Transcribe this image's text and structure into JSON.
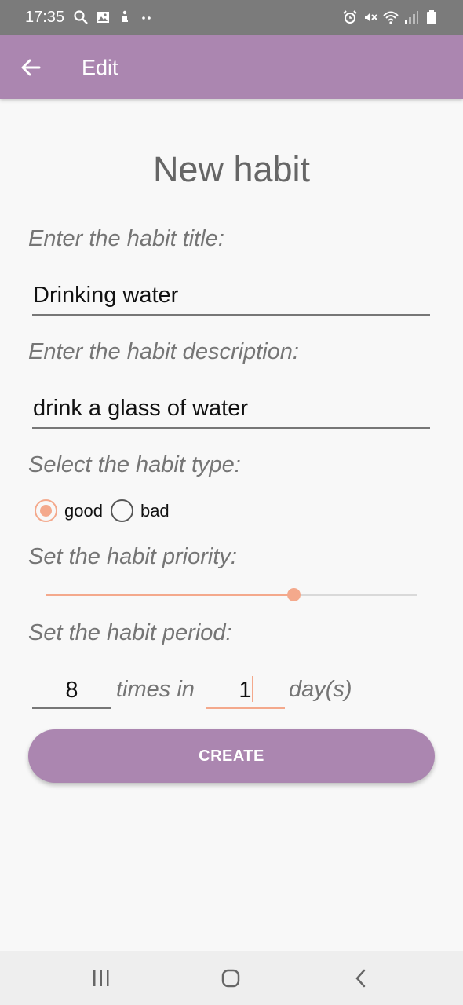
{
  "status_bar": {
    "time": "17:35",
    "left_icons": [
      "search-icon",
      "image-icon",
      "accessibility-icon",
      "more-dots-icon"
    ],
    "right_icons": [
      "alarm-icon",
      "mute-icon",
      "wifi-icon",
      "signal-icon",
      "battery-icon"
    ]
  },
  "app_bar": {
    "title": "Edit",
    "back_icon": "arrow-left-icon"
  },
  "form": {
    "heading": "New habit",
    "title_label": "Enter the habit title:",
    "title_value": "Drinking water",
    "description_label": "Enter the habit description:",
    "description_value": "drink a glass of water",
    "type_label": "Select the habit type:",
    "type_options": [
      "good",
      "bad"
    ],
    "type_selected": "good",
    "priority_label": "Set the habit priority:",
    "priority_fraction": 0.667,
    "period_label": "Set the habit period:",
    "times_value": "8",
    "times_in_text": "times in",
    "days_value": "1",
    "days_text": "day(s)",
    "create_label": "CREATE"
  },
  "colors": {
    "app_bar": "#ab86b0",
    "accent": "#f4a98c",
    "status_bar": "#7b7b7b",
    "background": "#f8f8f8"
  }
}
